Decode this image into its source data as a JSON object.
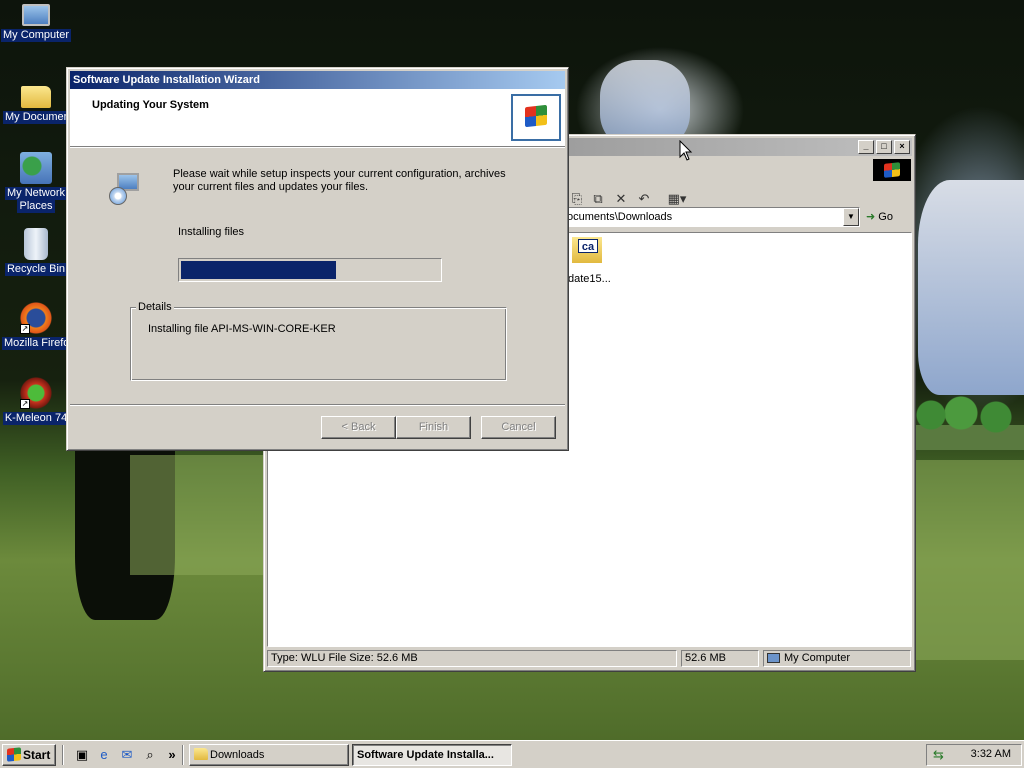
{
  "desktop": {
    "icons": [
      {
        "label": "My Computer"
      },
      {
        "label": "My Documents"
      },
      {
        "label": "My Network"
      },
      {
        "label": "Places"
      },
      {
        "label": "Recycle Bin"
      },
      {
        "label": "Mozilla Firefox"
      },
      {
        "label": "K-Meleon 74"
      }
    ]
  },
  "explorer": {
    "address": "ocuments\\Downloads",
    "go_label": "Go",
    "file_label": "date15...",
    "file_icon_text": "ca",
    "status": {
      "type_info": "Type: WLU File Size: 52.6 MB",
      "size": "52.6 MB",
      "zone": "My Computer"
    }
  },
  "wizard": {
    "title": "Software Update Installation Wizard",
    "header_title": "Updating Your System",
    "message": "Please wait while setup inspects your current configuration, archives your current files and updates your files.",
    "status_text": "Installing files",
    "progress": 0.6,
    "details_title": "Details",
    "detail_text": "Installing file API-MS-WIN-CORE-KER",
    "buttons": {
      "back": "< Back",
      "finish": "Finish",
      "cancel": "Cancel"
    }
  },
  "taskbar": {
    "start_label": "Start",
    "quick_launch_more": "»",
    "tasks": [
      {
        "label": "Downloads"
      },
      {
        "label": "Software Update Installa..."
      }
    ],
    "clock": "3:32 AM"
  },
  "colors": {
    "title_active": "#0a246a",
    "window_face": "#d4d0c8",
    "progress_fill": "#0a246a"
  }
}
